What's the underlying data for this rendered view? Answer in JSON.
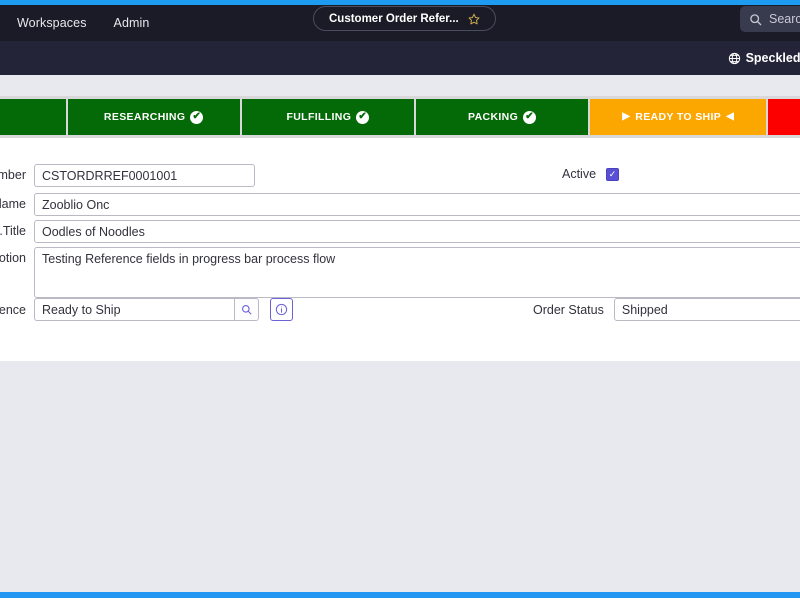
{
  "theme": {
    "accent_blue": "#1d9bf0",
    "nav_dark": "#1a1b26",
    "nav_dark_2": "#242439",
    "page_bg": "#e8e9ee",
    "seg_done": "#046907",
    "seg_current": "#fca600",
    "seg_next": "#fc0000",
    "checkbox_purple": "#5a50d4",
    "info_border": "#6c63d8"
  },
  "nav": {
    "links": [
      {
        "label": "Workspaces",
        "icon": "workspaces-icon"
      },
      {
        "label": "Admin",
        "icon": "admin-icon"
      }
    ],
    "tab": {
      "label": "Customer Order Refer...",
      "favorite_icon": "star-outline-icon"
    },
    "search": {
      "icon": "search-icon",
      "placeholder": "Search"
    },
    "environment": {
      "icon": "globe-icon",
      "label": "SpeckledFl..."
    }
  },
  "progress_bar": {
    "segments": [
      {
        "label": "",
        "state": "done",
        "icon": "",
        "partial": true
      },
      {
        "label": "RESEARCHING",
        "state": "done",
        "icon": "check-circle-icon",
        "partial": false
      },
      {
        "label": "FULFILLING",
        "state": "done",
        "icon": "check-circle-icon",
        "partial": false
      },
      {
        "label": "PACKING",
        "state": "done",
        "icon": "check-circle-icon",
        "partial": false
      },
      {
        "label": "READY TO SHIP",
        "state": "current",
        "icon": "arrow-markers",
        "partial": false
      },
      {
        "label": "",
        "state": "next",
        "icon": "",
        "partial": true
      }
    ]
  },
  "form": {
    "fields": {
      "number": {
        "label": "...mber",
        "value": "CSTORDRREF0001001",
        "placeholder": ""
      },
      "name": {
        "label": "...lame",
        "value": "Zooblio Onc",
        "placeholder": ""
      },
      "title": {
        "label": "...Title",
        "value": "Oodles of Noodles",
        "placeholder": ""
      },
      "description": {
        "label": "...otion",
        "value": "Testing Reference fields in progress bar process flow",
        "placeholder": ""
      },
      "reference": {
        "label": "...ence",
        "value": "Ready to Ship",
        "placeholder": "",
        "lookup_icon": "search-icon",
        "info_icon": "info-circle-icon"
      },
      "active": {
        "label": "Active",
        "checked": true,
        "check_glyph": "✓"
      },
      "order_status": {
        "label": "Order Status",
        "value": "Shipped",
        "placeholder": ""
      }
    }
  }
}
